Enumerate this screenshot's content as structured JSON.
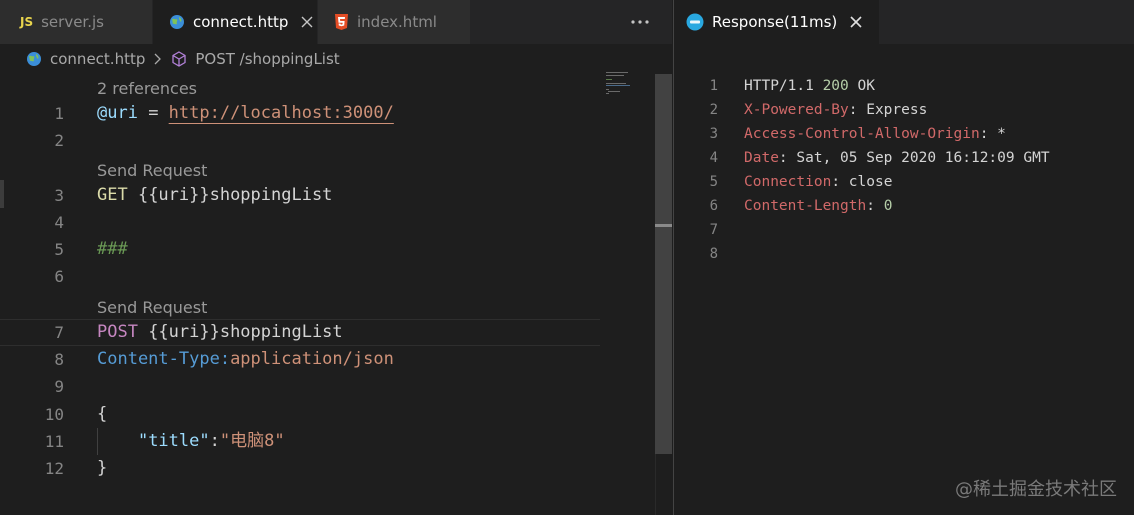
{
  "left_group": {
    "tabs": [
      {
        "label": "server.js",
        "icon": "js-icon",
        "active": false
      },
      {
        "label": "connect.http",
        "icon": "globe-icon",
        "active": true
      },
      {
        "label": "index.html",
        "icon": "html5-icon",
        "active": false
      }
    ],
    "more_actions": "···",
    "breadcrumb": {
      "file": "connect.http",
      "symbol": "POST /shoppingList"
    },
    "editor": {
      "code_lens": {
        "references": "2 references",
        "send_request_1": "Send Request",
        "send_request_2": "Send Request"
      },
      "lines": [
        {
          "num": "1",
          "tokens": [
            "@uri",
            " = ",
            "http://localhost:3000/"
          ]
        },
        {
          "num": "2",
          "tokens": []
        },
        {
          "num": "3",
          "tokens": [
            "GET",
            " {{uri}}shoppingList"
          ]
        },
        {
          "num": "4",
          "tokens": []
        },
        {
          "num": "5",
          "tokens": [
            "###"
          ]
        },
        {
          "num": "6",
          "tokens": []
        },
        {
          "num": "7",
          "tokens": [
            "POST",
            " {{uri}}shoppingList"
          ]
        },
        {
          "num": "8",
          "tokens": [
            "Content-Type:",
            "application/json"
          ]
        },
        {
          "num": "9",
          "tokens": []
        },
        {
          "num": "10",
          "tokens": [
            "{"
          ]
        },
        {
          "num": "11",
          "tokens": [
            "    ",
            "\"title\"",
            ":",
            "\"电脑8\""
          ]
        },
        {
          "num": "12",
          "tokens": [
            "}"
          ]
        }
      ]
    }
  },
  "right_group": {
    "tab": {
      "label": "Response(11ms)",
      "icon": "response-icon"
    },
    "lines": [
      {
        "num": "1",
        "tokens": [
          "HTTP/1.1 ",
          "200",
          " OK"
        ]
      },
      {
        "num": "2",
        "tokens": [
          "X-Powered-By",
          ": Express"
        ]
      },
      {
        "num": "3",
        "tokens": [
          "Access-Control-Allow-Origin",
          ": *"
        ]
      },
      {
        "num": "4",
        "tokens": [
          "Date",
          ": Sat, 05 Sep 2020 16:12:09 GMT"
        ]
      },
      {
        "num": "5",
        "tokens": [
          "Connection",
          ": close"
        ]
      },
      {
        "num": "6",
        "tokens": [
          "Content-Length",
          ": ",
          "0"
        ]
      },
      {
        "num": "7",
        "tokens": []
      },
      {
        "num": "8",
        "tokens": []
      }
    ]
  },
  "watermark": "@稀土掘金技术社区",
  "colors": {
    "editor_bg": "#1e1e1e",
    "tabbar_bg": "#252526",
    "variable": "#9cdcfe",
    "string": "#ce9178",
    "method_get": "#dcdcaa",
    "method_post": "#c586c0",
    "comment": "#6a9955",
    "header_name": "#569cd6",
    "response_header": "#d16969",
    "number": "#b5cea8"
  }
}
